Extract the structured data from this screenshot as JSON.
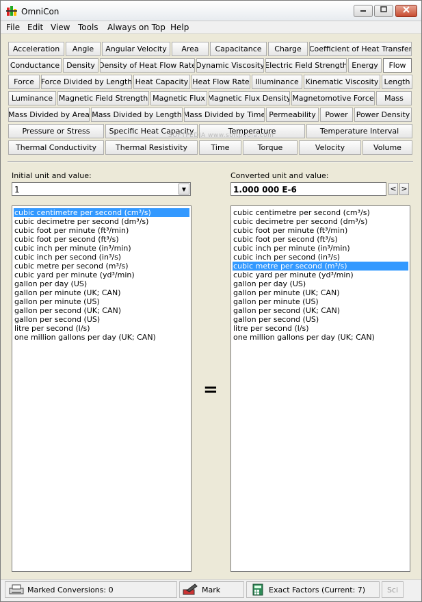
{
  "window": {
    "title": "OmniCon"
  },
  "menu": [
    "File",
    "Edit",
    "View",
    "Tools",
    "Always on Top",
    "Help"
  ],
  "unit_buttons": [
    "Acceleration",
    "Angle",
    "Angular Velocity",
    "Area",
    "Capacitance",
    "Charge",
    "Coefficient of Heat Transfer",
    "Conductance",
    "Density",
    "Density of Heat Flow Rate",
    "Dynamic Viscosity",
    "Electric Field Strength",
    "Energy",
    "Flow",
    "Force",
    "Force Divided by Length",
    "Heat Capacity",
    "Heat Flow Rate",
    "Illuminance",
    "Kinematic Viscosity",
    "Length",
    "Luminance",
    "Magnetic Field Strength",
    "Magnetic Flux",
    "Magnetic Flux Density",
    "Magnetomotive Force",
    "Mass",
    "Mass Divided by Area",
    "Mass Divided by Length",
    "Mass Divided by Time",
    "Permeability",
    "Power",
    "Power Density",
    "Pressure or Stress",
    "Specific Heat Capacity",
    "Temperature",
    "Temperature Interval",
    "Thermal Conductivity",
    "Thermal Resistivity",
    "Time",
    "Torque",
    "Velocity",
    "Volume"
  ],
  "active_category": "Flow",
  "watermark": "SOFTPEDIA www.softpedia.com",
  "initial": {
    "label": "Initial unit and value:",
    "value": "1"
  },
  "converted": {
    "label": "Converted unit and value:",
    "value": "1.000 000 E-6",
    "prev": "<",
    "next": ">"
  },
  "units": [
    "cubic centimetre per second (cm³/s)",
    "cubic decimetre per second (dm³/s)",
    "cubic foot per minute (ft³/min)",
    "cubic foot per second (ft³/s)",
    "cubic inch per minute (in³/min)",
    "cubic inch per second (in³/s)",
    "cubic metre per second (m³/s)",
    "cubic yard per minute (yd³/min)",
    "gallon per day (US)",
    "gallon per minute (UK; CAN)",
    "gallon per minute (US)",
    "gallon per second (UK; CAN)",
    "gallon per second (US)",
    "litre per second (l/s)",
    "one million gallons per day (UK; CAN)"
  ],
  "selected_left": 0,
  "selected_right": 6,
  "equals_sign": "=",
  "status": {
    "marked": "Marked Conversions: 0",
    "mark": "Mark",
    "exact": "Exact Factors  (Current: 7)",
    "sci": "Sci"
  }
}
